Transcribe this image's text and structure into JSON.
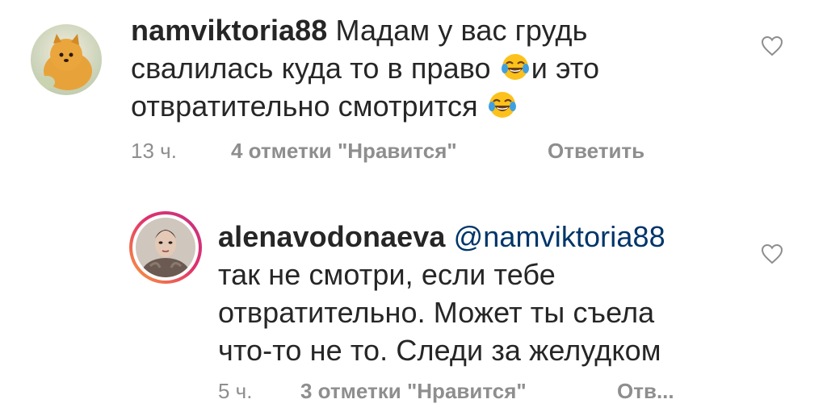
{
  "comments": [
    {
      "username": "namviktoria88",
      "text_line1": "Мадам у вас грудь",
      "text_line2a": "свалилась куда то в право",
      "text_line2b": "и это",
      "text_line3": "отвратительно смотрится",
      "emoji": "face-with-tears-of-joy-icon",
      "time": "13 ч.",
      "likes": "4 отметки \"Нравится\"",
      "reply": "Ответить"
    },
    {
      "username": "alenavodonaeva",
      "mention": "@namviktoria88",
      "text_line2": "так не смотри, если тебе",
      "text_line3": "отвратительно. Может ты съела",
      "text_line4": "что-то не то. Следи за желудком",
      "time": "5 ч.",
      "likes": "3 отметки \"Нравится\"",
      "reply": "Отв..."
    }
  ],
  "colors": {
    "text": "#262626",
    "meta": "#8e8e8e",
    "mention": "#003569",
    "story_ring_start": "#f9a13a",
    "story_ring_end": "#c13584"
  }
}
